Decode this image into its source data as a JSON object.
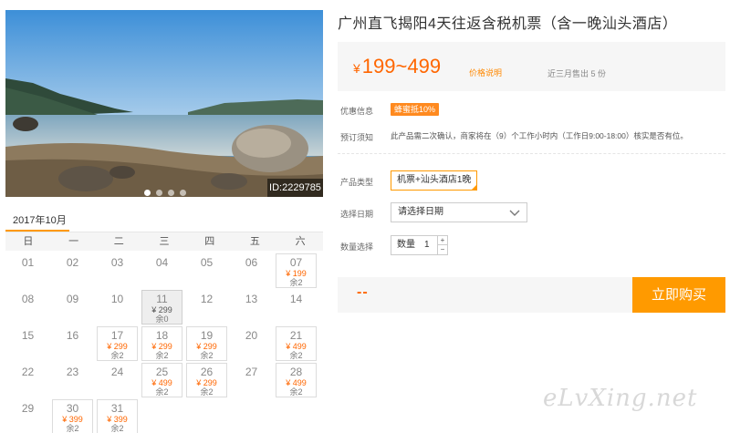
{
  "photo": {
    "image_id": "ID:2229785",
    "slides": 4,
    "active_slide": 1
  },
  "product": {
    "title": "广州直飞揭阳4天往返含税机票（含一晚汕头酒店）",
    "price_yen": "¥",
    "price_range": "199~499",
    "price_note": "价格说明",
    "sold_note": "近三月售出 5 份",
    "promo_label": "优惠信息",
    "promo_badge": "蜂蜜抵10%",
    "booking_label": "预订须知",
    "booking_text": "此产品需二次确认，商家将在（9）个工作小时内（工作日9:00-18:00）核实是否有位。",
    "type_label": "产品类型",
    "type_value": "机票+汕头酒店1晚",
    "date_label": "选择日期",
    "date_placeholder": "请选择日期",
    "qty_label": "数量选择",
    "qty_field_label": "数量",
    "qty_value": "1",
    "qty_up": "+",
    "qty_down": "−",
    "total": "--",
    "buy_label": "立即购买"
  },
  "calendar": {
    "month": "2017年10月",
    "weekdays": [
      "日",
      "一",
      "二",
      "三",
      "四",
      "五",
      "六"
    ],
    "days": [
      {
        "d": "01"
      },
      {
        "d": "02"
      },
      {
        "d": "03"
      },
      {
        "d": "04"
      },
      {
        "d": "05"
      },
      {
        "d": "06"
      },
      {
        "d": "07",
        "price": "¥ 199",
        "stock": "余2",
        "state": "avail"
      },
      {
        "d": "08"
      },
      {
        "d": "09"
      },
      {
        "d": "10"
      },
      {
        "d": "11",
        "price": "¥ 299",
        "stock": "余0",
        "state": "sold"
      },
      {
        "d": "12"
      },
      {
        "d": "13"
      },
      {
        "d": "14"
      },
      {
        "d": "15"
      },
      {
        "d": "16"
      },
      {
        "d": "17",
        "price": "¥ 299",
        "stock": "余2",
        "state": "avail"
      },
      {
        "d": "18",
        "price": "¥ 299",
        "stock": "余2",
        "state": "avail"
      },
      {
        "d": "19",
        "price": "¥ 299",
        "stock": "余2",
        "state": "avail"
      },
      {
        "d": "20"
      },
      {
        "d": "21",
        "price": "¥ 499",
        "stock": "余2",
        "state": "avail"
      },
      {
        "d": "22"
      },
      {
        "d": "23"
      },
      {
        "d": "24"
      },
      {
        "d": "25",
        "price": "¥ 499",
        "stock": "余2",
        "state": "avail"
      },
      {
        "d": "26",
        "price": "¥ 299",
        "stock": "余2",
        "state": "avail"
      },
      {
        "d": "27"
      },
      {
        "d": "28",
        "price": "¥ 499",
        "stock": "余2",
        "state": "avail"
      },
      {
        "d": "29"
      },
      {
        "d": "30",
        "price": "¥ 399",
        "stock": "余2",
        "state": "avail"
      },
      {
        "d": "31",
        "price": "¥ 399",
        "stock": "余2",
        "state": "avail"
      }
    ]
  },
  "watermark": "eLvXing.net",
  "colors": {
    "accent": "#ff9900",
    "price": "#ff6600",
    "buy_button": "#ff9a00"
  }
}
